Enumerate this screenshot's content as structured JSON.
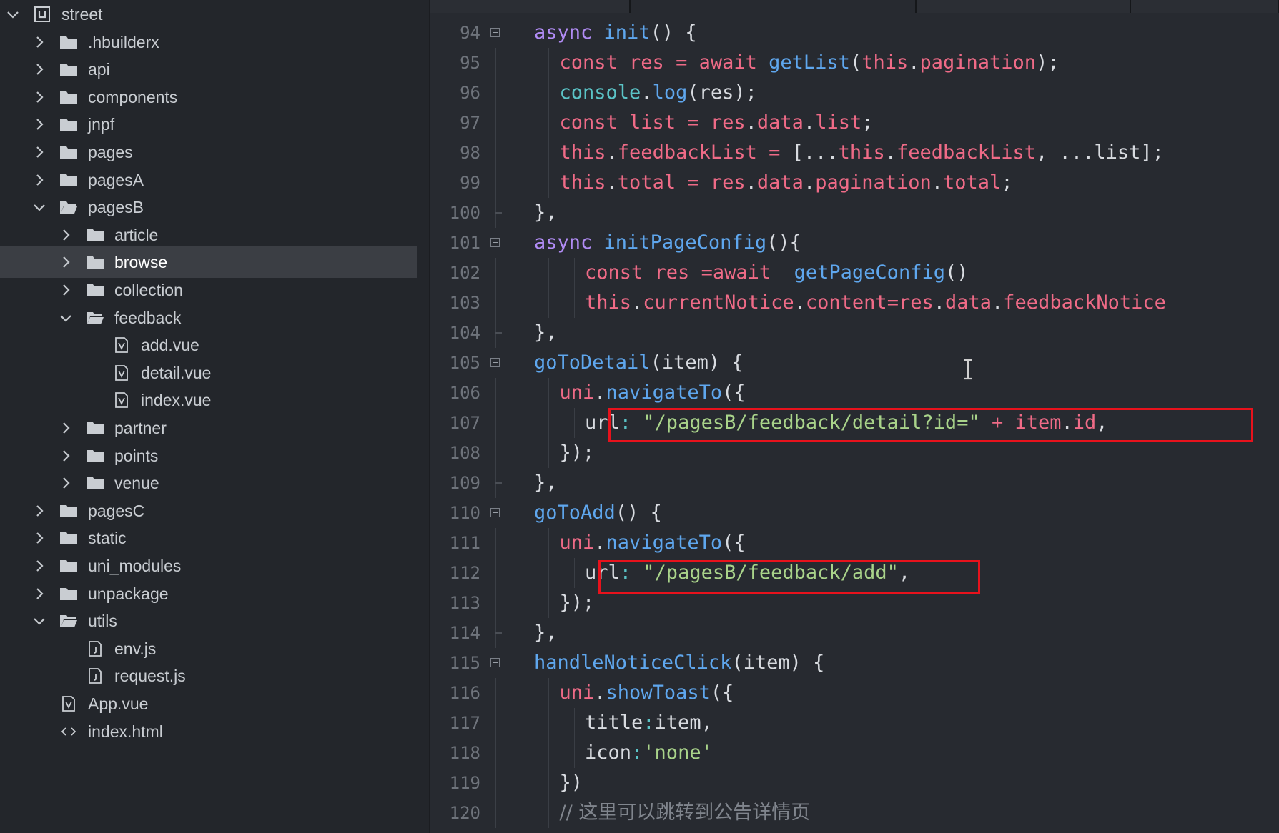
{
  "colors": {
    "sidebar_bg": "#23262b",
    "editor_bg": "#272a30",
    "selection_bg": "#3b3e44",
    "highlight_red": "#e8121c",
    "keyword": "#b18cf5",
    "function": "#5fa7ee",
    "variable": "#ef6b87",
    "string": "#a9d38a"
  },
  "explorer": {
    "items": [
      {
        "label": "street",
        "type": "project",
        "depth": 0,
        "expanded": true
      },
      {
        "label": ".hbuilderx",
        "type": "folder",
        "depth": 1,
        "expanded": false
      },
      {
        "label": "api",
        "type": "folder",
        "depth": 1,
        "expanded": false
      },
      {
        "label": "components",
        "type": "folder",
        "depth": 1,
        "expanded": false
      },
      {
        "label": "jnpf",
        "type": "folder",
        "depth": 1,
        "expanded": false
      },
      {
        "label": "pages",
        "type": "folder",
        "depth": 1,
        "expanded": false
      },
      {
        "label": "pagesA",
        "type": "folder",
        "depth": 1,
        "expanded": false
      },
      {
        "label": "pagesB",
        "type": "folder",
        "depth": 1,
        "expanded": true
      },
      {
        "label": "article",
        "type": "folder",
        "depth": 2,
        "expanded": false
      },
      {
        "label": "browse",
        "type": "folder",
        "depth": 2,
        "expanded": false,
        "selected": true
      },
      {
        "label": "collection",
        "type": "folder",
        "depth": 2,
        "expanded": false
      },
      {
        "label": "feedback",
        "type": "folder",
        "depth": 2,
        "expanded": true
      },
      {
        "label": "add.vue",
        "type": "vue",
        "depth": 3
      },
      {
        "label": "detail.vue",
        "type": "vue",
        "depth": 3
      },
      {
        "label": "index.vue",
        "type": "vue",
        "depth": 3
      },
      {
        "label": "partner",
        "type": "folder",
        "depth": 2,
        "expanded": false
      },
      {
        "label": "points",
        "type": "folder",
        "depth": 2,
        "expanded": false
      },
      {
        "label": "venue",
        "type": "folder",
        "depth": 2,
        "expanded": false
      },
      {
        "label": "pagesC",
        "type": "folder",
        "depth": 1,
        "expanded": false
      },
      {
        "label": "static",
        "type": "folder",
        "depth": 1,
        "expanded": false
      },
      {
        "label": "uni_modules",
        "type": "folder",
        "depth": 1,
        "expanded": false
      },
      {
        "label": "unpackage",
        "type": "folder",
        "depth": 1,
        "expanded": false
      },
      {
        "label": "utils",
        "type": "folder",
        "depth": 1,
        "expanded": true
      },
      {
        "label": "env.js",
        "type": "js",
        "depth": 2
      },
      {
        "label": "request.js",
        "type": "js",
        "depth": 2
      },
      {
        "label": "App.vue",
        "type": "vue",
        "depth": 1
      },
      {
        "label": "index.html",
        "type": "html",
        "depth": 1
      }
    ]
  },
  "editor": {
    "lines": [
      {
        "n": "94",
        "fold": "start",
        "indent": 1,
        "tokens": [
          [
            "kw",
            "async "
          ],
          [
            "fn",
            "init"
          ],
          [
            "pun",
            "() {"
          ]
        ]
      },
      {
        "n": "95",
        "indent": 2,
        "tokens": [
          [
            "var",
            "const "
          ],
          [
            "var",
            "res "
          ],
          [
            "op",
            "= "
          ],
          [
            "var",
            "await "
          ],
          [
            "fn",
            "getList"
          ],
          [
            "pun",
            "("
          ],
          [
            "var",
            "this"
          ],
          [
            "pun",
            "."
          ],
          [
            "var",
            "pagination"
          ],
          [
            "pun",
            ");"
          ]
        ]
      },
      {
        "n": "96",
        "indent": 2,
        "tokens": [
          [
            "prop",
            "console"
          ],
          [
            "pun",
            "."
          ],
          [
            "fn",
            "log"
          ],
          [
            "pun",
            "(res);"
          ]
        ]
      },
      {
        "n": "97",
        "indent": 2,
        "tokens": [
          [
            "var",
            "const "
          ],
          [
            "var",
            "list "
          ],
          [
            "op",
            "= "
          ],
          [
            "var",
            "res"
          ],
          [
            "pun",
            "."
          ],
          [
            "var",
            "data"
          ],
          [
            "pun",
            "."
          ],
          [
            "var",
            "list"
          ],
          [
            "pun",
            ";"
          ]
        ]
      },
      {
        "n": "98",
        "indent": 2,
        "tokens": [
          [
            "var",
            "this"
          ],
          [
            "pun",
            "."
          ],
          [
            "var",
            "feedbackList "
          ],
          [
            "op",
            "= "
          ],
          [
            "pun",
            "[..."
          ],
          [
            "var",
            "this"
          ],
          [
            "pun",
            "."
          ],
          [
            "var",
            "feedbackList"
          ],
          [
            "pun",
            ", ..."
          ],
          [
            "pun",
            "list];"
          ]
        ]
      },
      {
        "n": "99",
        "indent": 2,
        "tokens": [
          [
            "var",
            "this"
          ],
          [
            "pun",
            "."
          ],
          [
            "var",
            "total "
          ],
          [
            "op",
            "= "
          ],
          [
            "var",
            "res"
          ],
          [
            "pun",
            "."
          ],
          [
            "var",
            "data"
          ],
          [
            "pun",
            "."
          ],
          [
            "var",
            "pagination"
          ],
          [
            "pun",
            "."
          ],
          [
            "var",
            "total"
          ],
          [
            "pun",
            ";"
          ]
        ]
      },
      {
        "n": "100",
        "fold": "end",
        "indent": 1,
        "tokens": [
          [
            "pun",
            "},"
          ]
        ]
      },
      {
        "n": "101",
        "fold": "start",
        "indent": 1,
        "tokens": [
          [
            "kw",
            "async "
          ],
          [
            "fn",
            "initPageConfig"
          ],
          [
            "pun",
            "(){"
          ]
        ]
      },
      {
        "n": "102",
        "indent": 3,
        "tokens": [
          [
            "var",
            "const "
          ],
          [
            "var",
            "res "
          ],
          [
            "op",
            "="
          ],
          [
            "var",
            "await  "
          ],
          [
            "fn",
            "getPageConfig"
          ],
          [
            "pun",
            "()"
          ]
        ]
      },
      {
        "n": "103",
        "indent": 3,
        "tokens": [
          [
            "var",
            "this"
          ],
          [
            "pun",
            "."
          ],
          [
            "var",
            "currentNotice"
          ],
          [
            "pun",
            "."
          ],
          [
            "var",
            "content"
          ],
          [
            "op",
            "="
          ],
          [
            "var",
            "res"
          ],
          [
            "pun",
            "."
          ],
          [
            "var",
            "data"
          ],
          [
            "pun",
            "."
          ],
          [
            "var",
            "feedbackNotice"
          ]
        ]
      },
      {
        "n": "104",
        "fold": "end",
        "indent": 1,
        "tokens": [
          [
            "pun",
            "},"
          ]
        ]
      },
      {
        "n": "105",
        "fold": "start",
        "indent": 1,
        "tokens": [
          [
            "fn",
            "goToDetail"
          ],
          [
            "pun",
            "(item) {"
          ]
        ]
      },
      {
        "n": "106",
        "indent": 2,
        "tokens": [
          [
            "var",
            "uni"
          ],
          [
            "pun",
            "."
          ],
          [
            "fn",
            "navigateTo"
          ],
          [
            "pun",
            "({"
          ]
        ]
      },
      {
        "n": "107",
        "indent": 3,
        "tokens": [
          [
            "pun",
            "url"
          ],
          [
            "prop",
            ": "
          ],
          [
            "str",
            "\"/pagesB/feedback/detail?id=\" "
          ],
          [
            "op",
            "+ "
          ],
          [
            "var",
            "item"
          ],
          [
            "pun",
            "."
          ],
          [
            "var",
            "id"
          ],
          [
            "pun",
            ","
          ]
        ]
      },
      {
        "n": "108",
        "indent": 2,
        "tokens": [
          [
            "pun",
            "});"
          ]
        ]
      },
      {
        "n": "109",
        "fold": "end",
        "indent": 1,
        "tokens": [
          [
            "pun",
            "},"
          ]
        ]
      },
      {
        "n": "110",
        "fold": "start",
        "indent": 1,
        "tokens": [
          [
            "fn",
            "goToAdd"
          ],
          [
            "pun",
            "() {"
          ]
        ]
      },
      {
        "n": "111",
        "indent": 2,
        "tokens": [
          [
            "var",
            "uni"
          ],
          [
            "pun",
            "."
          ],
          [
            "fn",
            "navigateTo"
          ],
          [
            "pun",
            "({"
          ]
        ]
      },
      {
        "n": "112",
        "indent": 3,
        "tokens": [
          [
            "pun",
            "url"
          ],
          [
            "prop",
            ": "
          ],
          [
            "str",
            "\"/pagesB/feedback/add\""
          ],
          [
            "pun",
            ","
          ]
        ]
      },
      {
        "n": "113",
        "indent": 2,
        "tokens": [
          [
            "pun",
            "});"
          ]
        ]
      },
      {
        "n": "114",
        "fold": "end",
        "indent": 1,
        "tokens": [
          [
            "pun",
            "},"
          ]
        ]
      },
      {
        "n": "115",
        "fold": "start",
        "indent": 1,
        "tokens": [
          [
            "fn",
            "handleNoticeClick"
          ],
          [
            "pun",
            "(item) {"
          ]
        ]
      },
      {
        "n": "116",
        "indent": 2,
        "tokens": [
          [
            "var",
            "uni"
          ],
          [
            "pun",
            "."
          ],
          [
            "fn",
            "showToast"
          ],
          [
            "pun",
            "({"
          ]
        ]
      },
      {
        "n": "117",
        "indent": 3,
        "tokens": [
          [
            "pun",
            "title"
          ],
          [
            "prop",
            ":"
          ],
          [
            "pun",
            "item,"
          ]
        ]
      },
      {
        "n": "118",
        "indent": 3,
        "tokens": [
          [
            "pun",
            "icon"
          ],
          [
            "prop",
            ":"
          ],
          [
            "str",
            "'none'"
          ]
        ]
      },
      {
        "n": "119",
        "indent": 2,
        "tokens": [
          [
            "pun",
            "})"
          ]
        ]
      },
      {
        "n": "120",
        "indent": 2,
        "tokens": [
          [
            "cmt",
            "// 这里可以跳转到公告详情页"
          ]
        ]
      }
    ]
  }
}
